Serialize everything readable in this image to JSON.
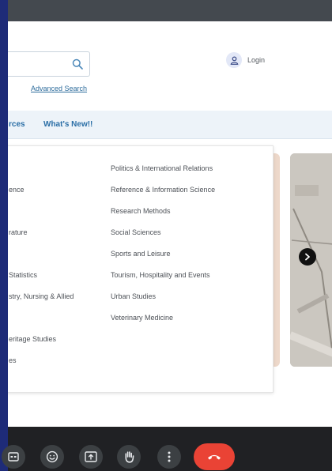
{
  "header": {
    "advanced_search": "Advanced Search",
    "login_label": "Login"
  },
  "nav": {
    "items": [
      "rces",
      "What's New!!"
    ]
  },
  "dropdown": {
    "left_column": [
      "ence",
      "rature",
      "Statistics",
      "stry, Nursing & Allied",
      "eritage Studies",
      "es"
    ],
    "right_column": [
      "Politics & International Relations",
      "Reference & Information Science",
      "Research Methods",
      "Social Sciences",
      "Sports and Leisure",
      "Tourism, Hospitality and Events",
      "Urban Studies",
      "Veterinary Medicine"
    ]
  },
  "icons": {
    "search": "search-icon",
    "user": "user-icon",
    "carousel_next": "chevron-right-icon",
    "captions": "closed-captions-icon",
    "emoji": "emoji-icon",
    "present": "present-screen-icon",
    "hand": "raise-hand-icon",
    "more": "more-vertical-icon",
    "end_call": "end-call-icon"
  },
  "colors": {
    "link": "#2d6c9c",
    "nav_bg": "#edf3f9",
    "end_call": "#ea4335",
    "call_bar": "#202124"
  }
}
